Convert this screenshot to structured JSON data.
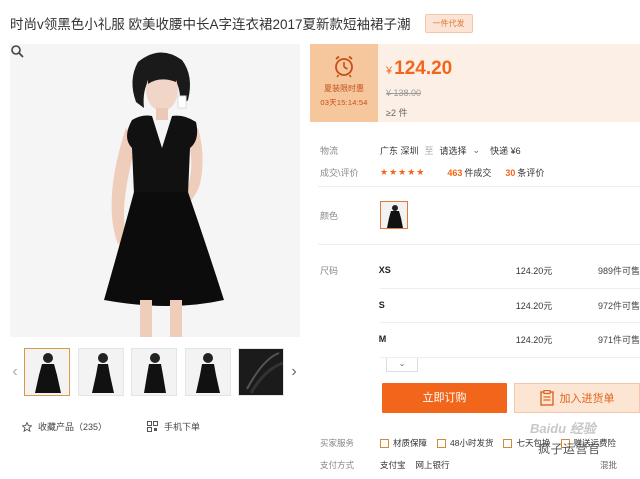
{
  "product": {
    "title": "时尚v领黑色小礼服 欧美收腰中长A字连衣裙2017夏新款短袖裙子潮",
    "badge": "一件代发"
  },
  "price": {
    "promo_label": "夏装限时惠",
    "promo_time": "03天15:14:54",
    "currency": "¥",
    "amount": "124.20",
    "original": "¥ 138.00",
    "min_qty": "≥2 件"
  },
  "shipping": {
    "label": "物流",
    "location": "广东 深圳",
    "to": "至",
    "choose": "请选择",
    "method": "快递 ¥6"
  },
  "deals": {
    "label": "成交\\评价",
    "stars": "★★★★★",
    "deal_count": "463",
    "deal_text": "件成交",
    "review_count": "30",
    "review_text": "条评价"
  },
  "color": {
    "label": "颜色"
  },
  "sizes": {
    "label": "尺码",
    "rows": [
      {
        "name": "XS",
        "price": "124.20元",
        "stock": "989件可售"
      },
      {
        "name": "S",
        "price": "124.20元",
        "stock": "972件可售"
      },
      {
        "name": "M",
        "price": "124.20元",
        "stock": "971件可售"
      }
    ],
    "more": "⌄"
  },
  "buttons": {
    "order": "立即订购",
    "cart": "加入进货单"
  },
  "service": {
    "label": "买家服务",
    "items": [
      "材质保障",
      "48小时发货",
      "七天包换",
      "赠送运费险"
    ]
  },
  "payment": {
    "label": "支付方式",
    "items": [
      "支付宝",
      "网上银行"
    ],
    "right": "混批"
  },
  "left_actions": {
    "favorite": "收藏产品（235）",
    "mobile": "手机下单"
  },
  "watermark": {
    "text": "疯子运营官",
    "baidu": "Baidu 经验"
  },
  "colors": {
    "accent": "#f2661b",
    "promo_bg": "#f6c79d",
    "price_bg": "#fcf0e6"
  }
}
